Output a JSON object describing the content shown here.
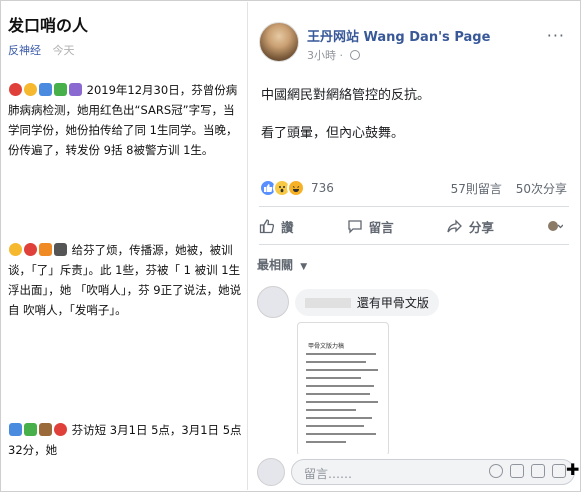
{
  "article": {
    "title": "发口哨の人",
    "source": "反神经",
    "time": "今天",
    "para1": "2019年12月30日，芬曾份病肺病病检测，她用红色出“SARS冠”字写，当学同学份，她份拍传给了同 1生同学。当晚，份传遍了，转发份 9括 8被警方训 1生。",
    "para2": "给芬了烦，传播源，她被，被训谈，「了」斥责」。此 1些，芬被「 1 被训 1生浮出面」，她 「吹哨人」，芬 9正了说法，她说自 吹哨人，「发哨子」。",
    "para3": "芬访短 3月1日 5点，3月1日 5点32分，她"
  },
  "post": {
    "page_name": "王丹网站 Wang Dan's Page",
    "time": "3小時",
    "more": "···",
    "line1": "中國網民對網絡管控的反抗。",
    "line2": "看了頭暈，但內心鼓舞。",
    "reaction_count": "736",
    "comments_count": "57則留言",
    "shares_count": "50次分享",
    "like_label": "讚",
    "comment_label": "留言",
    "share_label": "分享",
    "sort_label": "最相關",
    "comment_text": "還有甲骨文版",
    "doc_title": "甲骨文版力稿",
    "reply_placeholder": "留言……"
  },
  "colors": {
    "link": "#385898",
    "meta": "#90949c",
    "accent_red": "#e0403a"
  }
}
